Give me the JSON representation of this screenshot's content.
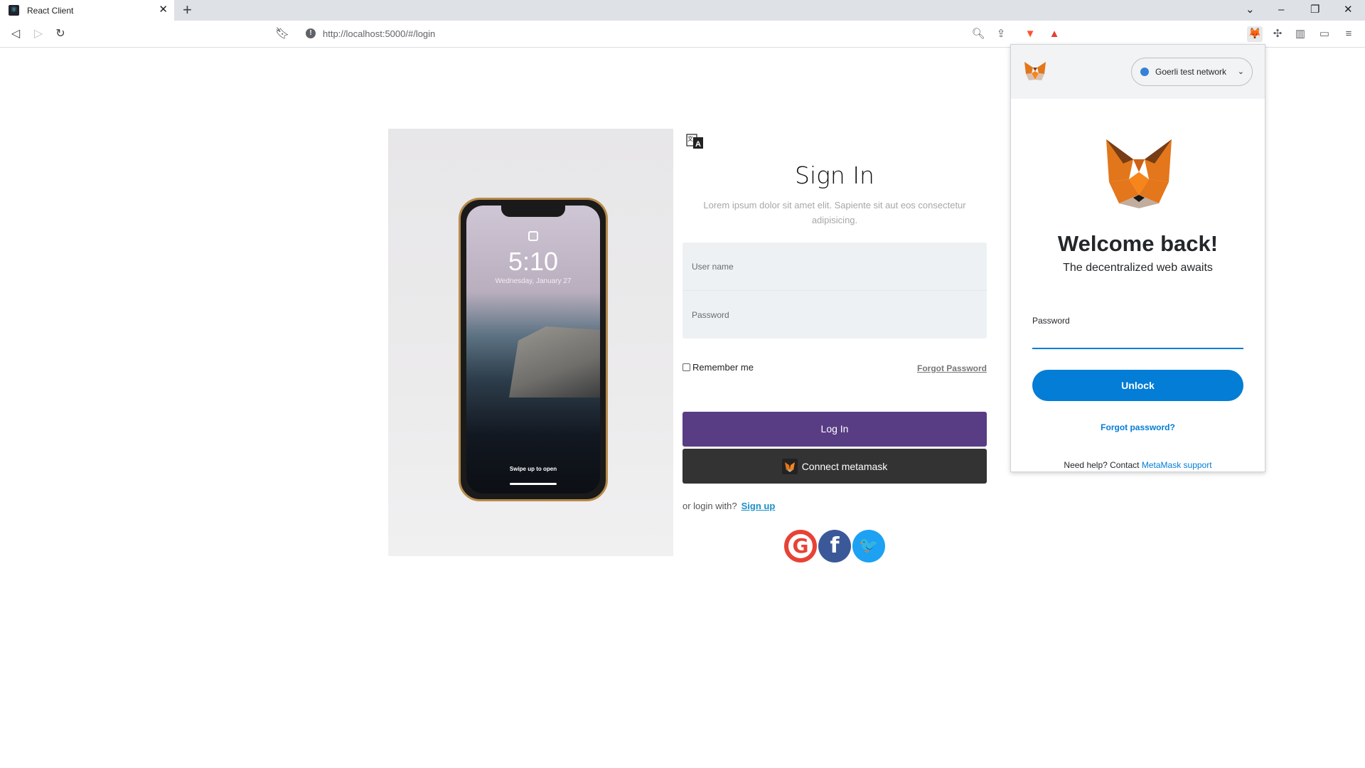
{
  "browser": {
    "tab_title": "React Client",
    "tab_close": "✕",
    "new_tab": "+",
    "url": "http://localhost:5000/#/login",
    "window_controls": [
      "⌄",
      "–",
      "❐",
      "✕"
    ]
  },
  "page": {
    "phone": {
      "time": "5:10",
      "date": "Wednesday, January 27",
      "swipe_text": "Swipe up to open"
    },
    "title": "Sign In",
    "subtitle": "Lorem ipsum dolor sit amet elit. Sapiente sit aut eos consectetur adipisicing.",
    "username_placeholder": "User name",
    "password_placeholder": "Password",
    "remember_label": "Remember me",
    "forgot_label": "Forgot Password",
    "login_button": "Log In",
    "metamask_button": "Connect metamask",
    "or_login": "or login with?",
    "signup_link": "Sign up",
    "social": [
      {
        "name": "google",
        "glyph": "G"
      },
      {
        "name": "facebook",
        "glyph": "f"
      },
      {
        "name": "twitter",
        "glyph": "🐦"
      }
    ]
  },
  "metamask": {
    "network": "Goerli test network",
    "welcome": "Welcome back!",
    "tagline": "The decentralized web awaits",
    "password_label": "Password",
    "unlock_button": "Unlock",
    "forgot_link": "Forgot password?",
    "help_prefix": "Need help? Contact",
    "help_link": "MetaMask support"
  },
  "colors": {
    "login_button": "#593d84",
    "metamask_button": "#333333",
    "metamask_blue": "#037dd6",
    "network_dot": "#3481d8"
  }
}
